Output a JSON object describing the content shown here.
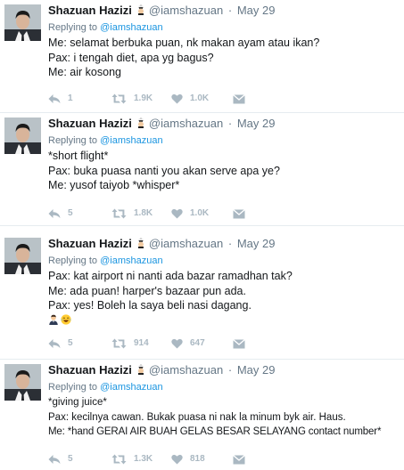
{
  "colors": {
    "name": "#14171a",
    "muted": "#657786",
    "link": "#1b95e0",
    "action": "#aab8c2",
    "divider": "#e6ecf0"
  },
  "icons": [
    "verified-badge-icon",
    "reply-icon",
    "retweet-icon",
    "like-heart-icon",
    "direct-message-icon"
  ],
  "tweets": [
    {
      "name": "Shazuan Hazizi",
      "screen_name": "@iamshazuan",
      "separator": "·",
      "date": "May 29",
      "reply_prefix": "Replying to",
      "reply_handle": "@iamshazuan",
      "lines": [
        "Me: selamat berbuka puan, nk makan ayam atau ikan?",
        "Pax: i tengah diet, apa yg bagus?",
        "Me: air kosong"
      ],
      "replies": "1",
      "retweets": "1.9K",
      "likes": "1.0K"
    },
    {
      "name": "Shazuan Hazizi",
      "screen_name": "@iamshazuan",
      "separator": "·",
      "date": "May 29",
      "reply_prefix": "Replying to",
      "reply_handle": "@iamshazuan",
      "lines": [
        "*short flight*",
        "Pax: buka puasa nanti you akan serve apa ye?",
        "Me: yusof taiyob *whisper*"
      ],
      "replies": "5",
      "retweets": "1.8K",
      "likes": "1.0K"
    },
    {
      "name": "Shazuan Hazizi",
      "screen_name": "@iamshazuan",
      "separator": "·",
      "date": "May 29",
      "reply_prefix": "Replying to",
      "reply_handle": "@iamshazuan",
      "lines": [
        "Pax: kat airport ni nanti ada bazar ramadhan tak?",
        "Me: ada puan! harper's bazaar pun ada.",
        "Pax: yes! Boleh la saya beli nasi dagang."
      ],
      "emoji": [
        "man-emoji",
        "laughing-emoji"
      ],
      "replies": "5",
      "retweets": "914",
      "likes": "647"
    },
    {
      "name": "Shazuan Hazizi",
      "screen_name": "@iamshazuan",
      "separator": "·",
      "date": "May 29",
      "reply_prefix": "Replying to",
      "reply_handle": "@iamshazuan",
      "lines": [
        "*giving juice*",
        "Pax: kecilnya cawan. Bukak puasa ni nak la minum byk air. Haus.",
        "Me: *hand GERAI AIR BUAH GELAS BESAR SELAYANG contact number*"
      ],
      "replies": "5",
      "retweets": "1.3K",
      "likes": "818"
    }
  ]
}
